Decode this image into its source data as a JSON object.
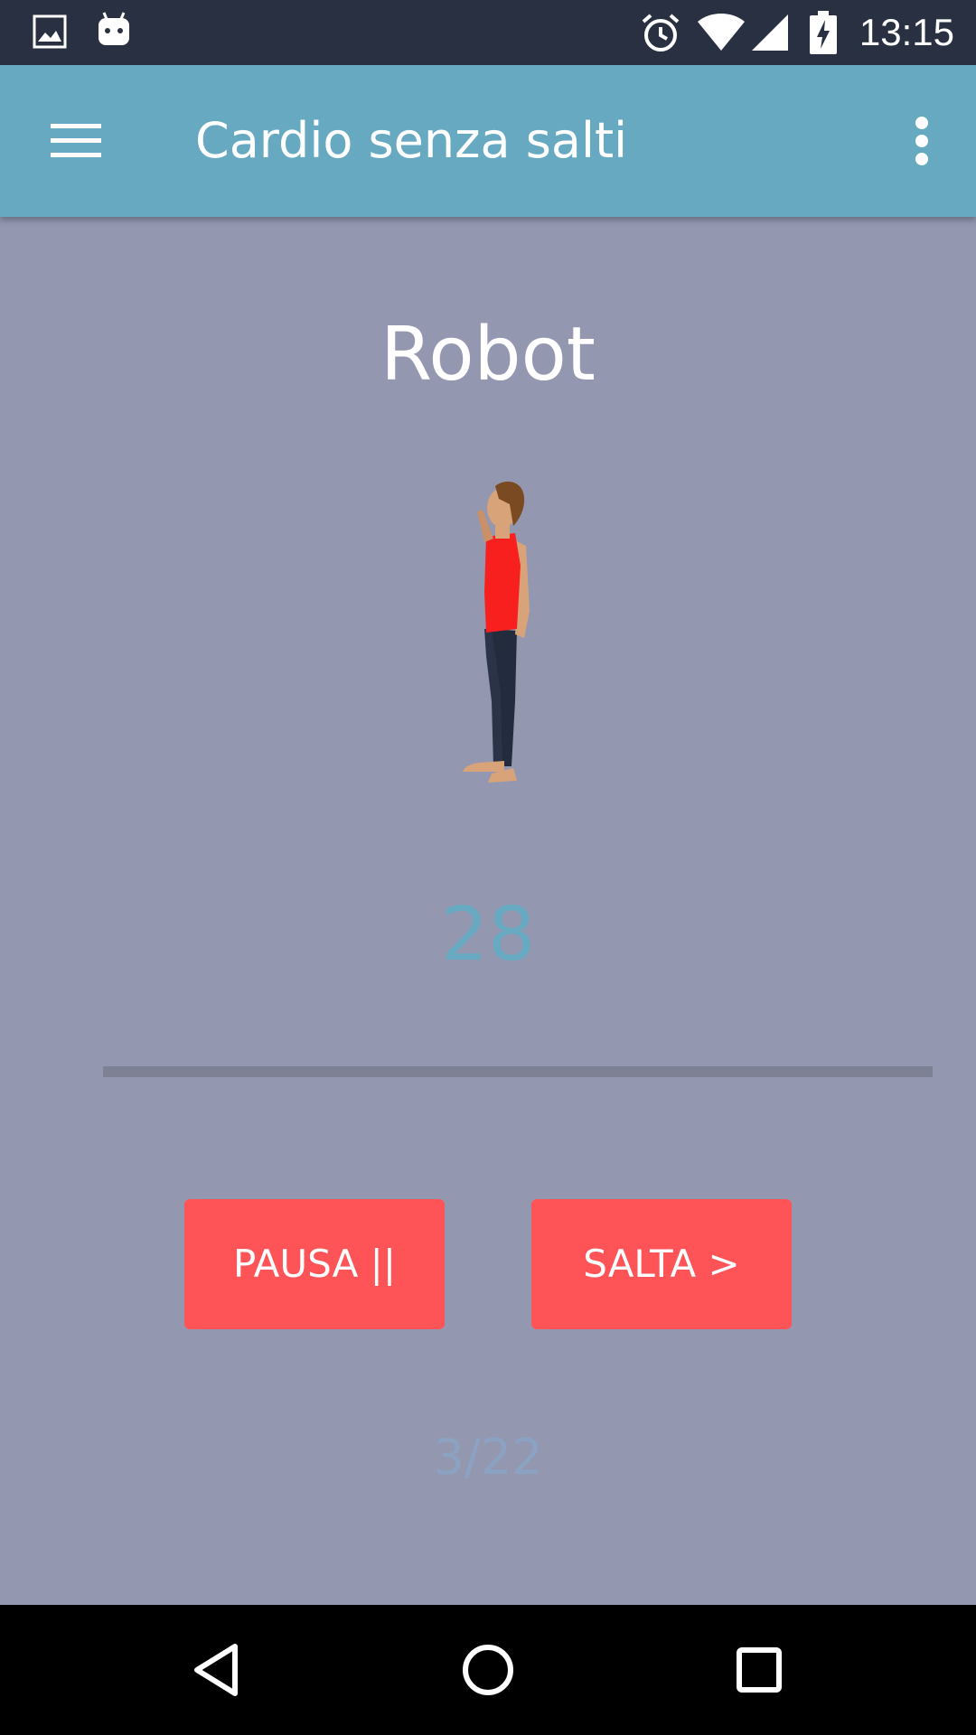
{
  "status_bar": {
    "time": "13:15",
    "left_icons": [
      "image-icon",
      "android-icon"
    ],
    "right_icons": [
      "alarm-icon",
      "wifi-icon",
      "signal-icon",
      "battery-charging-icon"
    ]
  },
  "app_bar": {
    "title": "Cardio senza salti",
    "menu_icon": "hamburger-menu-icon",
    "overflow_icon": "more-vert-icon",
    "color": "#67a9c1"
  },
  "exercise": {
    "name": "Robot",
    "seconds_remaining": "28",
    "progress_fraction": 1.0,
    "step_counter": "3/22"
  },
  "buttons": {
    "pause_label": "PAUSA ||",
    "skip_label": "SALTA >",
    "color": "#fe5357"
  },
  "nav_bar": {
    "icons": [
      "back-icon",
      "home-icon",
      "recents-icon"
    ]
  },
  "colors": {
    "background": "#9397b0",
    "status_bar": "#283042",
    "accent_text": "#67a9c1"
  }
}
